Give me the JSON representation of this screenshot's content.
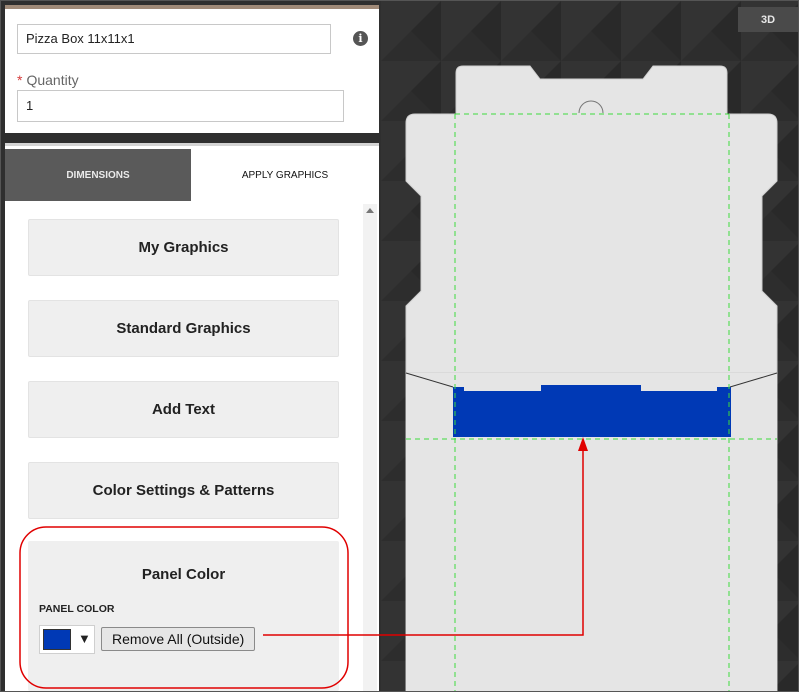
{
  "product": {
    "name_value": "Pizza Box 11x11x1",
    "info_icon": "info-icon",
    "quantity_label": "Quantity",
    "quantity_required_mark": "*",
    "quantity_value": "1"
  },
  "tabs": [
    {
      "label": "DIMENSIONS",
      "active": false
    },
    {
      "label": "APPLY GRAPHICS",
      "active": true
    }
  ],
  "menu": {
    "my_graphics": "My Graphics",
    "standard_graphics": "Standard Graphics",
    "add_text": "Add Text",
    "color_settings": "Color Settings & Patterns"
  },
  "panel_color": {
    "title": "Panel Color",
    "label": "PANEL COLOR",
    "swatch_color": "#0039b5",
    "dropdown_icon": "chevron-down-icon",
    "remove_button": "Remove All (Outside)"
  },
  "canvas": {
    "view_button": "3D",
    "panel_fill_color": "#0039b5",
    "guide_color": "#3ddc3d",
    "annotation_color": "#e00000"
  }
}
